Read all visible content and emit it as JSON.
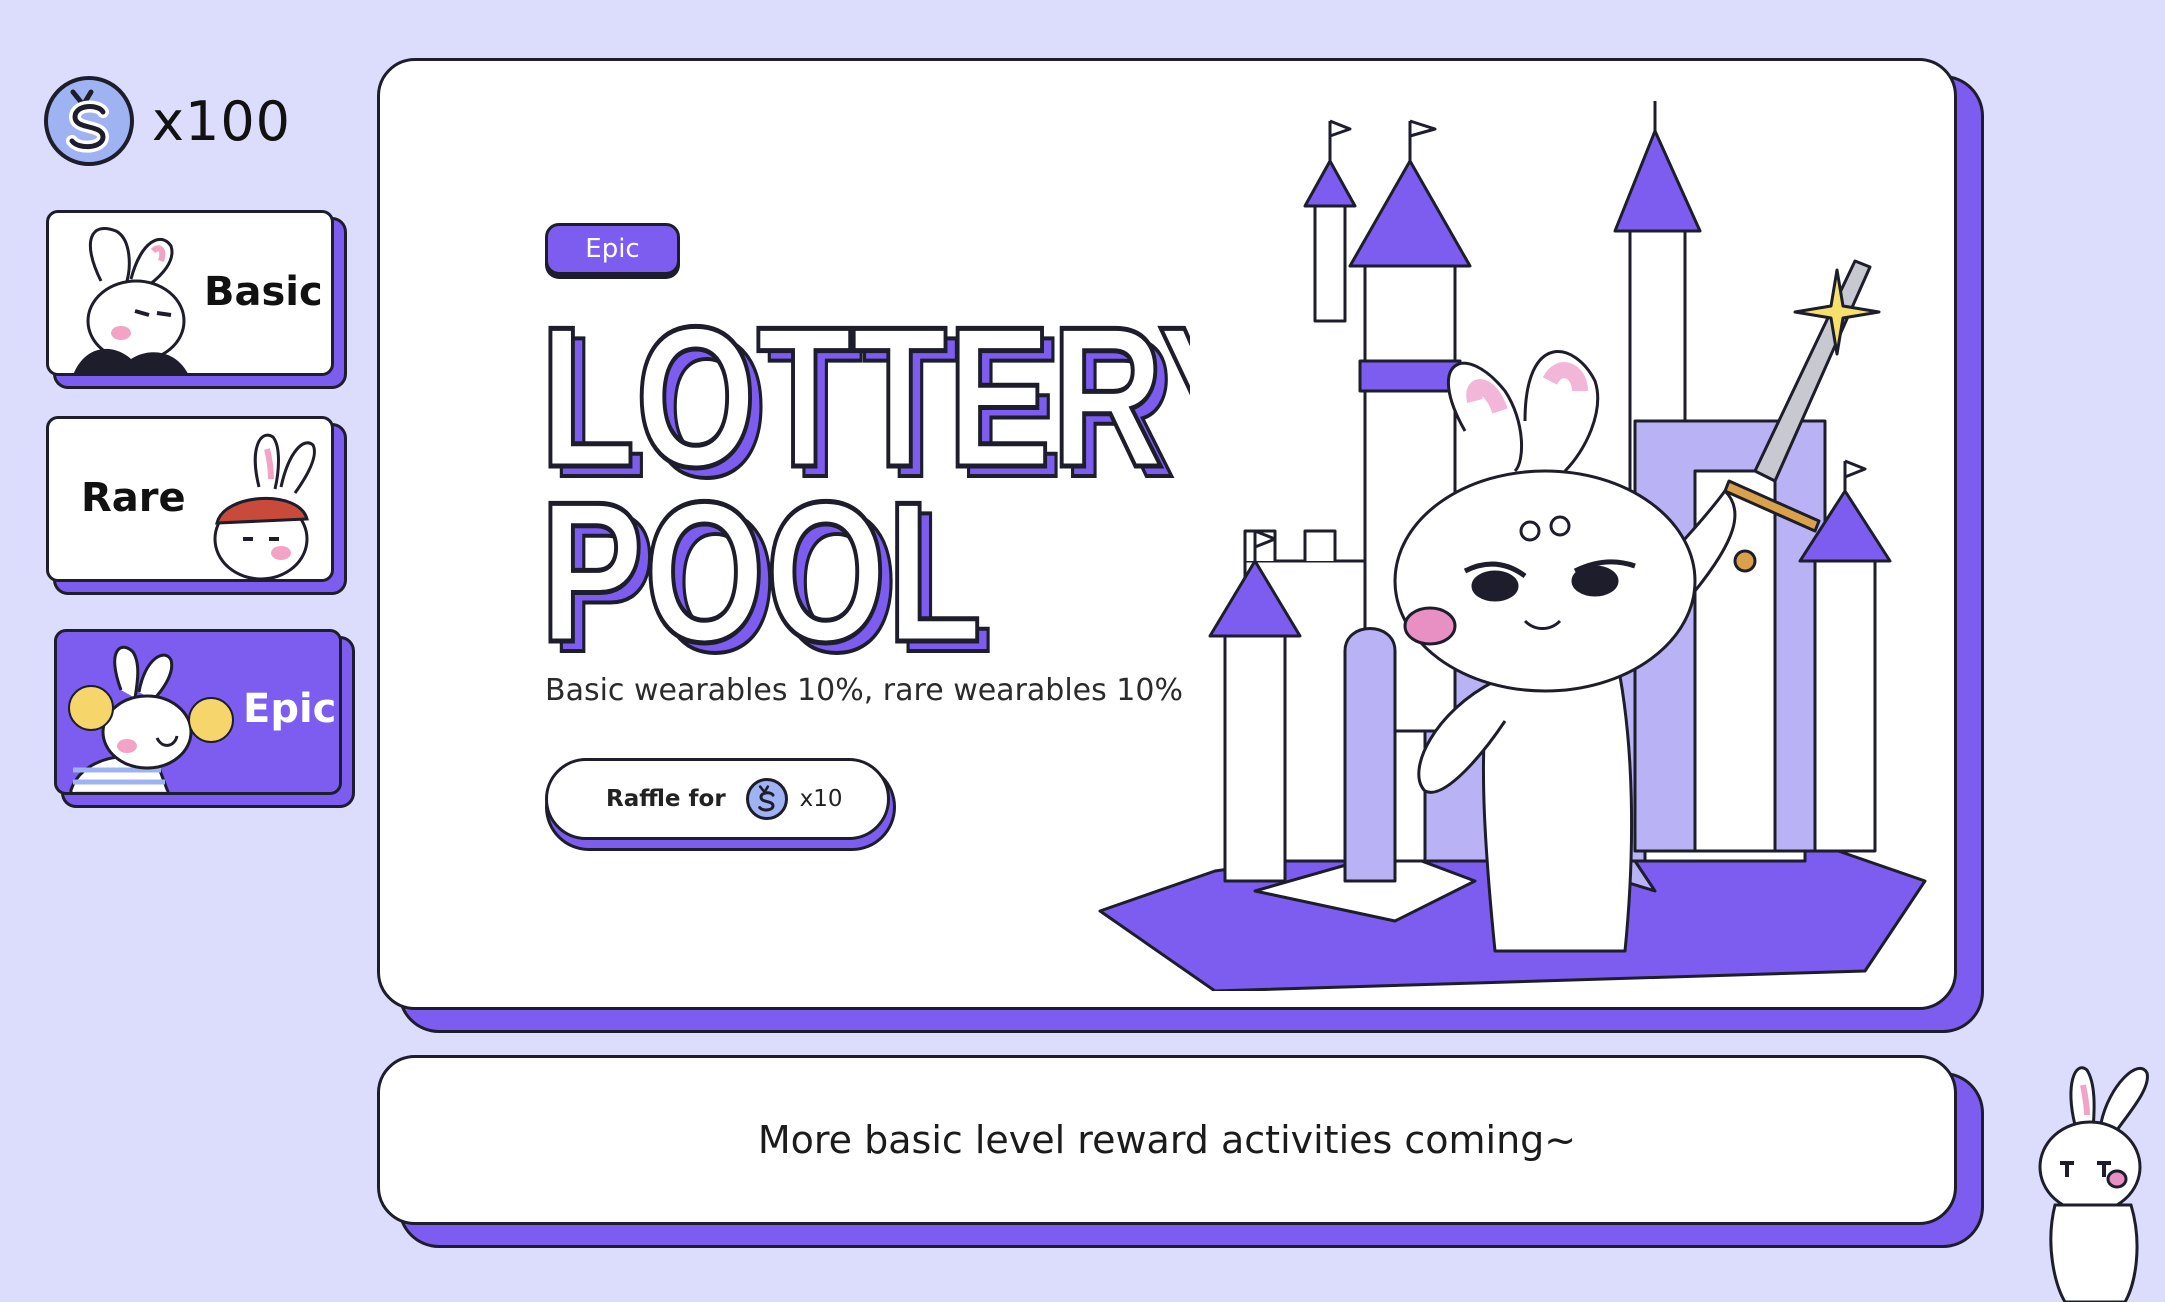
{
  "balance": {
    "amount": "x100",
    "icon": "coin-icon"
  },
  "tiers": [
    {
      "label": "Basic",
      "active": false
    },
    {
      "label": "Rare",
      "active": false
    },
    {
      "label": "Epic",
      "active": true
    }
  ],
  "pool": {
    "badge": "Epic",
    "title_line1": "LOTTERY",
    "title_line2": "POOL",
    "subtitle": "Basic wearables 10%, rare wearables 10%",
    "raffle_label": "Raffle for",
    "raffle_cost": "x10"
  },
  "footer_note": "More basic level reward activities coming~",
  "colors": {
    "background": "#dcdcfd",
    "accent": "#7d5cf0",
    "coin": "#9fb3f3",
    "outline": "#1d1d2b"
  }
}
